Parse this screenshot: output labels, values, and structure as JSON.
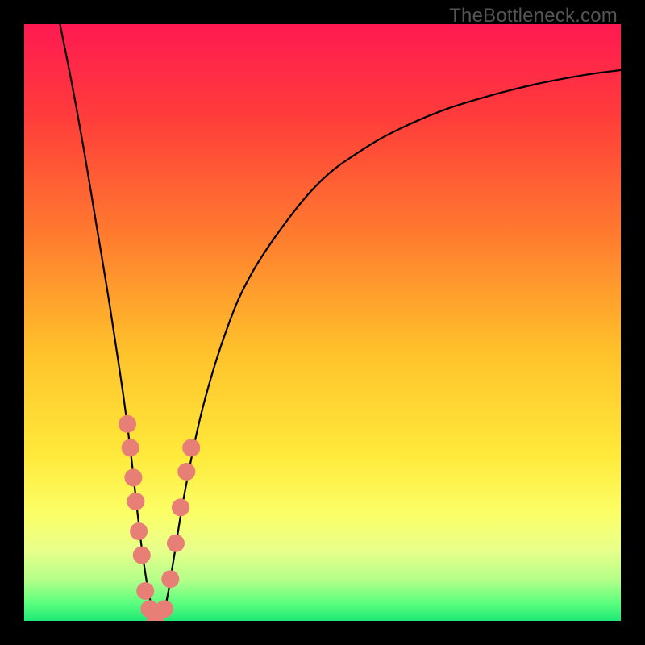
{
  "watermark": "TheBottleneck.com",
  "colors": {
    "frame": "#000000",
    "curve": "#000000",
    "marker_fill": "#e77f77",
    "marker_stroke": "#d96a62"
  },
  "chart_data": {
    "type": "line",
    "title": "",
    "xlabel": "",
    "ylabel": "",
    "xlim": [
      0,
      100
    ],
    "ylim": [
      0,
      100
    ],
    "gradient_stops": [
      {
        "offset": 0.0,
        "color": "#ff1a52"
      },
      {
        "offset": 0.15,
        "color": "#ff3b3b"
      },
      {
        "offset": 0.35,
        "color": "#ff7a2f"
      },
      {
        "offset": 0.55,
        "color": "#ffc22b"
      },
      {
        "offset": 0.72,
        "color": "#ffe93a"
      },
      {
        "offset": 0.82,
        "color": "#fbff66"
      },
      {
        "offset": 0.88,
        "color": "#e9ff8a"
      },
      {
        "offset": 0.93,
        "color": "#b6ff8a"
      },
      {
        "offset": 0.97,
        "color": "#5dff7e"
      },
      {
        "offset": 1.0,
        "color": "#1fe876"
      }
    ],
    "series": [
      {
        "name": "bottleneck-curve",
        "x": [
          6,
          8,
          10,
          12,
          14,
          16,
          17,
          18,
          19,
          20,
          21,
          22,
          23,
          24,
          25,
          27,
          30,
          34,
          38,
          44,
          50,
          56,
          62,
          70,
          78,
          86,
          94,
          100
        ],
        "y": [
          100,
          90,
          79,
          67,
          55,
          42,
          35,
          27,
          18,
          10,
          4,
          0,
          0,
          4,
          10,
          22,
          36,
          49,
          58,
          67,
          74,
          78.5,
          82,
          85.5,
          88,
          90,
          91.5,
          92.3
        ]
      }
    ],
    "markers": {
      "name": "highlight-points",
      "points": [
        {
          "x": 17.3,
          "y": 33
        },
        {
          "x": 17.8,
          "y": 29
        },
        {
          "x": 18.3,
          "y": 24
        },
        {
          "x": 18.7,
          "y": 20
        },
        {
          "x": 19.2,
          "y": 15
        },
        {
          "x": 19.7,
          "y": 11
        },
        {
          "x": 20.3,
          "y": 5
        },
        {
          "x": 21,
          "y": 2
        },
        {
          "x": 22,
          "y": 0
        },
        {
          "x": 23.5,
          "y": 2
        },
        {
          "x": 24.5,
          "y": 7
        },
        {
          "x": 25.4,
          "y": 13
        },
        {
          "x": 26.2,
          "y": 19
        },
        {
          "x": 27.2,
          "y": 25
        },
        {
          "x": 28.0,
          "y": 29
        }
      ]
    }
  }
}
